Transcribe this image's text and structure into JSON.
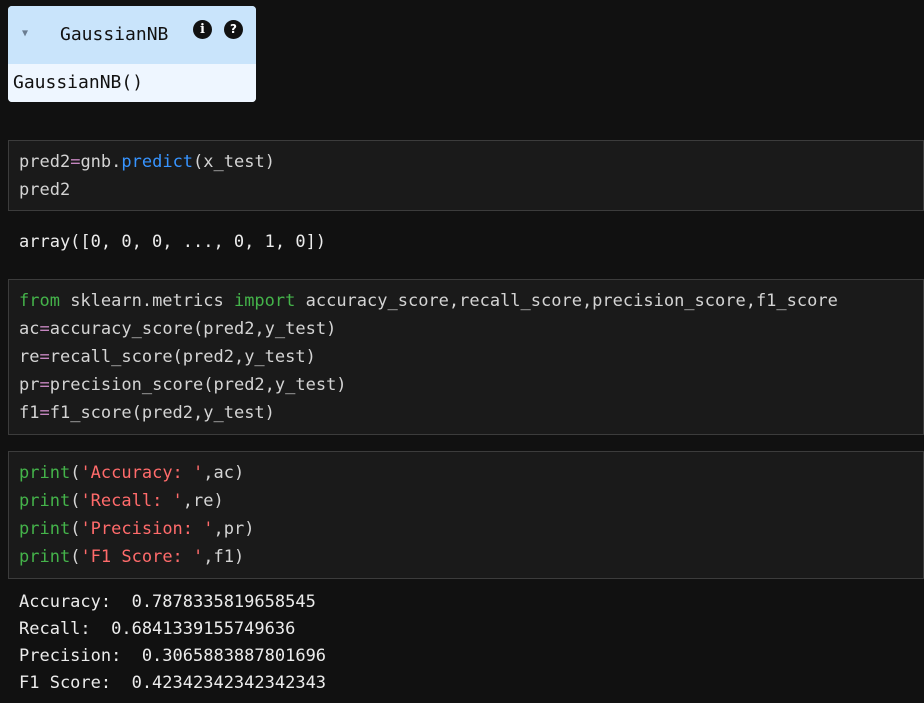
{
  "estimator": {
    "name": "GaussianNB",
    "info_icon": "info-icon",
    "help_icon": "help-icon",
    "repr": "GaussianNB()"
  },
  "cells": {
    "c1": {
      "line1": {
        "var": "pred2",
        "eq": "=",
        "obj": "gnb.",
        "fn": "predict",
        "args": "(x_test)"
      },
      "line2": "pred2"
    },
    "c1_output": "array([0, 0, 0, ..., 0, 1, 0])",
    "c2": {
      "line1": {
        "kw_from": "from",
        "module": " sklearn.metrics ",
        "kw_import": "import",
        "names": " accuracy_score,recall_score,precision_score,f1_score"
      },
      "line2": {
        "var": "ac",
        "eq": "=",
        "rest": "accuracy_score(pred2,y_test)"
      },
      "line3": {
        "var": "re",
        "eq": "=",
        "rest": "recall_score(pred2,y_test)"
      },
      "line4": {
        "var": "pr",
        "eq": "=",
        "rest": "precision_score(pred2,y_test)"
      },
      "line5": {
        "var": "f1",
        "eq": "=",
        "rest": "f1_score(pred2,y_test)"
      }
    },
    "c3": {
      "line1": {
        "fn": "print",
        "open": "(",
        "str": "'Accuracy: '",
        "rest": ",ac)"
      },
      "line2": {
        "fn": "print",
        "open": "(",
        "str": "'Recall: '",
        "rest": ",re)"
      },
      "line3": {
        "fn": "print",
        "open": "(",
        "str": "'Precision: '",
        "rest": ",pr)"
      },
      "line4": {
        "fn": "print",
        "open": "(",
        "str": "'F1 Score: '",
        "rest": ",f1)"
      }
    },
    "c3_output": {
      "line1": "Accuracy:  0.7878335819658545",
      "line2": "Recall:  0.6841339155749636",
      "line3": "Precision:  0.3065883887801696",
      "line4": "F1 Score:  0.42342342342342343"
    }
  },
  "colors": {
    "background": "#111111",
    "cell_bg": "#1a1a1a",
    "keyword": "#44b34a",
    "function": "#3794ff",
    "operator": "#c586c0",
    "string": "#ff6b6b",
    "estimator_header": "#c9e4fb",
    "estimator_body": "#eef6ff"
  }
}
